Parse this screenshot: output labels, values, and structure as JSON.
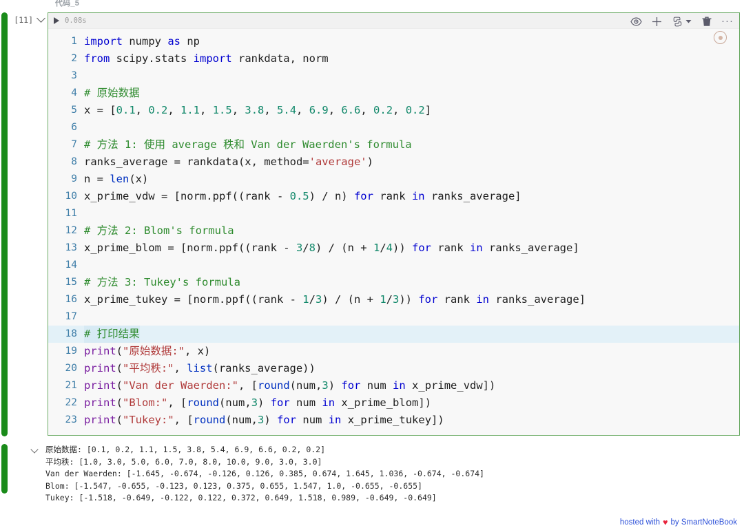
{
  "cell": {
    "title": "代码_5",
    "execution_count": "[11]",
    "execution_time": "0.08s",
    "collapse_icon": "chevron-down-icon",
    "run_icon": "play-icon",
    "selection_color": "#1a8b1a",
    "border_color": "#6aaa64",
    "background_color": "#f8f8f8"
  },
  "toolbar": {
    "items": [
      {
        "name": "eye-icon",
        "label": "Show/Hide"
      },
      {
        "name": "plus-icon",
        "label": "Add Cell"
      },
      {
        "name": "python-kernel-icon",
        "label": "Kernel"
      },
      {
        "name": "chevron-down-icon",
        "label": "Kernel Menu"
      },
      {
        "name": "trash-icon",
        "label": "Delete Cell"
      },
      {
        "name": "more-options-icon",
        "label": "···"
      }
    ],
    "more_label": "···",
    "kernel_badge": "kernel-status-icon"
  },
  "code": {
    "lines": [
      {
        "no": "1",
        "tokens": [
          {
            "t": "import",
            "c": "k"
          },
          {
            "t": " numpy ",
            "c": "p"
          },
          {
            "t": "as",
            "c": "k"
          },
          {
            "t": " np",
            "c": "p"
          }
        ]
      },
      {
        "no": "2",
        "tokens": [
          {
            "t": "from",
            "c": "k"
          },
          {
            "t": " scipy.stats ",
            "c": "p"
          },
          {
            "t": "import",
            "c": "k"
          },
          {
            "t": " rankdata, norm",
            "c": "p"
          }
        ]
      },
      {
        "no": "3",
        "tokens": []
      },
      {
        "no": "4",
        "tokens": [
          {
            "t": "# 原始数据",
            "c": "c"
          }
        ]
      },
      {
        "no": "5",
        "tokens": [
          {
            "t": "x = [",
            "c": "p"
          },
          {
            "t": "0.1",
            "c": "n"
          },
          {
            "t": ", ",
            "c": "p"
          },
          {
            "t": "0.2",
            "c": "n"
          },
          {
            "t": ", ",
            "c": "p"
          },
          {
            "t": "1.1",
            "c": "n"
          },
          {
            "t": ", ",
            "c": "p"
          },
          {
            "t": "1.5",
            "c": "n"
          },
          {
            "t": ", ",
            "c": "p"
          },
          {
            "t": "3.8",
            "c": "n"
          },
          {
            "t": ", ",
            "c": "p"
          },
          {
            "t": "5.4",
            "c": "n"
          },
          {
            "t": ", ",
            "c": "p"
          },
          {
            "t": "6.9",
            "c": "n"
          },
          {
            "t": ", ",
            "c": "p"
          },
          {
            "t": "6.6",
            "c": "n"
          },
          {
            "t": ", ",
            "c": "p"
          },
          {
            "t": "0.2",
            "c": "n"
          },
          {
            "t": ", ",
            "c": "p"
          },
          {
            "t": "0.2",
            "c": "n"
          },
          {
            "t": "]",
            "c": "p"
          }
        ]
      },
      {
        "no": "6",
        "tokens": []
      },
      {
        "no": "7",
        "tokens": [
          {
            "t": "# 方法 1: 使用 average 秩和 Van der Waerden's formula",
            "c": "c"
          }
        ]
      },
      {
        "no": "8",
        "tokens": [
          {
            "t": "ranks_average = rankdata(x, method=",
            "c": "p"
          },
          {
            "t": "'average'",
            "c": "s"
          },
          {
            "t": ")",
            "c": "p"
          }
        ]
      },
      {
        "no": "9",
        "tokens": [
          {
            "t": "n = ",
            "c": "p"
          },
          {
            "t": "len",
            "c": "b"
          },
          {
            "t": "(x)",
            "c": "p"
          }
        ]
      },
      {
        "no": "10",
        "tokens": [
          {
            "t": "x_prime_vdw = [norm.ppf((rank - ",
            "c": "p"
          },
          {
            "t": "0.5",
            "c": "n"
          },
          {
            "t": ") / n) ",
            "c": "p"
          },
          {
            "t": "for",
            "c": "k"
          },
          {
            "t": " rank ",
            "c": "p"
          },
          {
            "t": "in",
            "c": "k"
          },
          {
            "t": " ranks_average]",
            "c": "p"
          }
        ]
      },
      {
        "no": "11",
        "tokens": []
      },
      {
        "no": "12",
        "tokens": [
          {
            "t": "# 方法 2: Blom's formula",
            "c": "c"
          }
        ]
      },
      {
        "no": "13",
        "tokens": [
          {
            "t": "x_prime_blom = [norm.ppf((rank - ",
            "c": "p"
          },
          {
            "t": "3",
            "c": "n"
          },
          {
            "t": "/",
            "c": "p"
          },
          {
            "t": "8",
            "c": "n"
          },
          {
            "t": ") / (n + ",
            "c": "p"
          },
          {
            "t": "1",
            "c": "n"
          },
          {
            "t": "/",
            "c": "p"
          },
          {
            "t": "4",
            "c": "n"
          },
          {
            "t": ")) ",
            "c": "p"
          },
          {
            "t": "for",
            "c": "k"
          },
          {
            "t": " rank ",
            "c": "p"
          },
          {
            "t": "in",
            "c": "k"
          },
          {
            "t": " ranks_average]",
            "c": "p"
          }
        ]
      },
      {
        "no": "14",
        "tokens": []
      },
      {
        "no": "15",
        "tokens": [
          {
            "t": "# 方法 3: Tukey's formula",
            "c": "c"
          }
        ]
      },
      {
        "no": "16",
        "tokens": [
          {
            "t": "x_prime_tukey = [norm.ppf((rank - ",
            "c": "p"
          },
          {
            "t": "1",
            "c": "n"
          },
          {
            "t": "/",
            "c": "p"
          },
          {
            "t": "3",
            "c": "n"
          },
          {
            "t": ") / (n + ",
            "c": "p"
          },
          {
            "t": "1",
            "c": "n"
          },
          {
            "t": "/",
            "c": "p"
          },
          {
            "t": "3",
            "c": "n"
          },
          {
            "t": ")) ",
            "c": "p"
          },
          {
            "t": "for",
            "c": "k"
          },
          {
            "t": " rank ",
            "c": "p"
          },
          {
            "t": "in",
            "c": "k"
          },
          {
            "t": " ranks_average]",
            "c": "p"
          }
        ]
      },
      {
        "no": "17",
        "tokens": []
      },
      {
        "no": "18",
        "active": true,
        "tokens": [
          {
            "t": "# 打印结果",
            "c": "c"
          }
        ]
      },
      {
        "no": "19",
        "tokens": [
          {
            "t": "print",
            "c": "bp"
          },
          {
            "t": "(",
            "c": "p"
          },
          {
            "t": "\"原始数据:\"",
            "c": "s"
          },
          {
            "t": ", x)",
            "c": "p"
          }
        ]
      },
      {
        "no": "20",
        "tokens": [
          {
            "t": "print",
            "c": "bp"
          },
          {
            "t": "(",
            "c": "p"
          },
          {
            "t": "\"平均秩:\"",
            "c": "s"
          },
          {
            "t": ", ",
            "c": "p"
          },
          {
            "t": "list",
            "c": "b"
          },
          {
            "t": "(ranks_average))",
            "c": "p"
          }
        ]
      },
      {
        "no": "21",
        "tokens": [
          {
            "t": "print",
            "c": "bp"
          },
          {
            "t": "(",
            "c": "p"
          },
          {
            "t": "\"Van der Waerden:\"",
            "c": "s"
          },
          {
            "t": ", [",
            "c": "p"
          },
          {
            "t": "round",
            "c": "b"
          },
          {
            "t": "(num,",
            "c": "p"
          },
          {
            "t": "3",
            "c": "n"
          },
          {
            "t": ") ",
            "c": "p"
          },
          {
            "t": "for",
            "c": "k"
          },
          {
            "t": " num ",
            "c": "p"
          },
          {
            "t": "in",
            "c": "k"
          },
          {
            "t": " x_prime_vdw])",
            "c": "p"
          }
        ]
      },
      {
        "no": "22",
        "tokens": [
          {
            "t": "print",
            "c": "bp"
          },
          {
            "t": "(",
            "c": "p"
          },
          {
            "t": "\"Blom:\"",
            "c": "s"
          },
          {
            "t": ", [",
            "c": "p"
          },
          {
            "t": "round",
            "c": "b"
          },
          {
            "t": "(num,",
            "c": "p"
          },
          {
            "t": "3",
            "c": "n"
          },
          {
            "t": ") ",
            "c": "p"
          },
          {
            "t": "for",
            "c": "k"
          },
          {
            "t": " num ",
            "c": "p"
          },
          {
            "t": "in",
            "c": "k"
          },
          {
            "t": " x_prime_blom])",
            "c": "p"
          }
        ]
      },
      {
        "no": "23",
        "tokens": [
          {
            "t": "print",
            "c": "bp"
          },
          {
            "t": "(",
            "c": "p"
          },
          {
            "t": "\"Tukey:\"",
            "c": "s"
          },
          {
            "t": ", [",
            "c": "p"
          },
          {
            "t": "round",
            "c": "b"
          },
          {
            "t": "(num,",
            "c": "p"
          },
          {
            "t": "3",
            "c": "n"
          },
          {
            "t": ") ",
            "c": "p"
          },
          {
            "t": "for",
            "c": "k"
          },
          {
            "t": " num ",
            "c": "p"
          },
          {
            "t": "in",
            "c": "k"
          },
          {
            "t": " x_prime_tukey])",
            "c": "p"
          }
        ]
      }
    ]
  },
  "output": {
    "collapse_icon": "chevron-down-icon",
    "lines": [
      "原始数据: [0.1, 0.2, 1.1, 1.5, 3.8, 5.4, 6.9, 6.6, 0.2, 0.2]",
      "平均秩: [1.0, 3.0, 5.0, 6.0, 7.0, 8.0, 10.0, 9.0, 3.0, 3.0]",
      "Van der Waerden: [-1.645, -0.674, -0.126, 0.126, 0.385, 0.674, 1.645, 1.036, -0.674, -0.674]",
      "Blom: [-1.547, -0.655, -0.123, 0.123, 0.375, 0.655, 1.547, 1.0, -0.655, -0.655]",
      "Tukey: [-1.518, -0.649, -0.122, 0.122, 0.372, 0.649, 1.518, 0.989, -0.649, -0.649]"
    ]
  },
  "footer": {
    "prefix": "hosted with",
    "heart": "♥",
    "suffix": "by SmartNoteBook",
    "link_color": "#2b4fd8",
    "heart_color": "#e8243c"
  }
}
